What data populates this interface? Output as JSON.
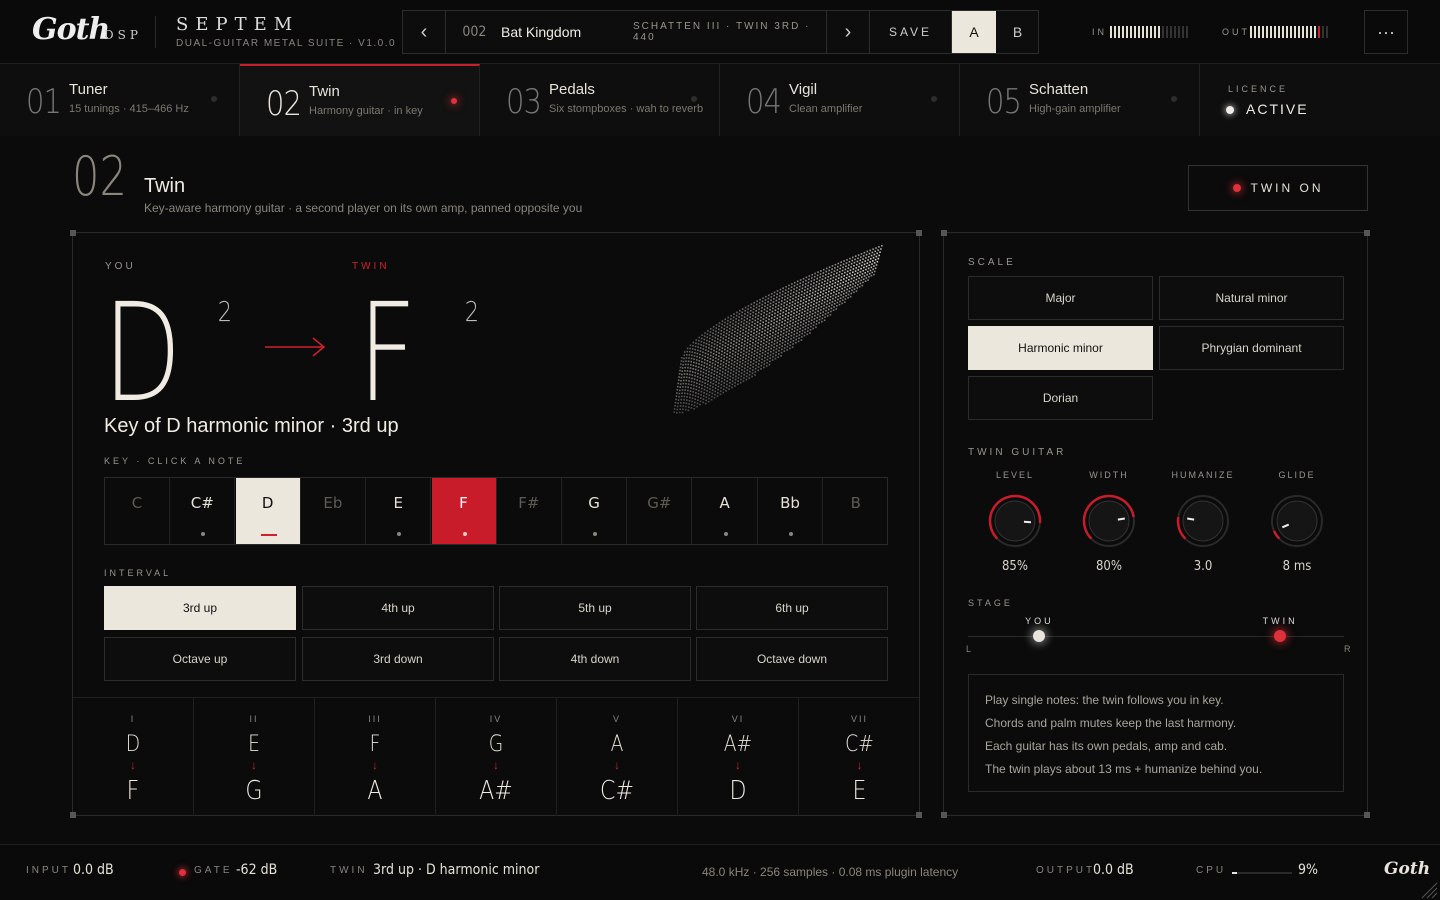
{
  "brand": {
    "logo": "Goth",
    "dsp": "DSP",
    "product": "SEPTEM",
    "subtitle": "DUAL-GUITAR METAL SUITE · V1.0.0"
  },
  "preset": {
    "number": "002",
    "name": "Bat Kingdom",
    "detail": "SCHATTEN III · TWIN 3RD · 440",
    "save": "SAVE",
    "a": "A",
    "b": "B",
    "prev": "‹",
    "next": "›"
  },
  "meters": {
    "in_label": "IN",
    "out_label": "OUT",
    "in_level": 0.67,
    "out_level": 0.89
  },
  "menu": "···",
  "tabs": [
    {
      "num": "01",
      "title": "Tuner",
      "sub": "15 tunings · 415–466 Hz"
    },
    {
      "num": "02",
      "title": "Twin",
      "sub": "Harmony guitar · in key"
    },
    {
      "num": "03",
      "title": "Pedals",
      "sub": "Six stompboxes · wah to reverb"
    },
    {
      "num": "04",
      "title": "Vigil",
      "sub": "Clean amplifier"
    },
    {
      "num": "05",
      "title": "Schatten",
      "sub": "High-gain amplifier"
    }
  ],
  "licence": {
    "label": "LICENCE",
    "value": "ACTIVE"
  },
  "page": {
    "num": "02",
    "title": "Twin",
    "desc": "Key-aware harmony guitar · a second player on its own amp, panned opposite you",
    "toggle": "TWIN ON"
  },
  "harmony": {
    "you_label": "YOU",
    "twin_label": "TWIN",
    "you_note": "D",
    "you_oct": "2",
    "twin_note": "F",
    "twin_oct": "2",
    "summary": "Key of D harmonic minor · 3rd up",
    "key_label": "KEY · CLICK A NOTE"
  },
  "keys": [
    "C",
    "C#",
    "D",
    "Eb",
    "E",
    "F",
    "F#",
    "G",
    "G#",
    "A",
    "Bb",
    "B"
  ],
  "interval": {
    "label": "INTERVAL",
    "options": [
      "3rd up",
      "4th up",
      "5th up",
      "6th up",
      "Octave up",
      "3rd down",
      "4th down",
      "Octave down"
    ]
  },
  "degrees": [
    {
      "roman": "I",
      "from": "D",
      "to": "F"
    },
    {
      "roman": "II",
      "from": "E",
      "to": "G"
    },
    {
      "roman": "III",
      "from": "F",
      "to": "A"
    },
    {
      "roman": "IV",
      "from": "G",
      "to": "A#"
    },
    {
      "roman": "V",
      "from": "A",
      "to": "C#"
    },
    {
      "roman": "VI",
      "from": "A#",
      "to": "D"
    },
    {
      "roman": "VII",
      "from": "C#",
      "to": "E"
    }
  ],
  "scale": {
    "label": "SCALE",
    "options": [
      "Major",
      "Natural minor",
      "Harmonic minor",
      "Phrygian dominant",
      "Dorian"
    ],
    "selected": "Harmonic minor"
  },
  "twin_guitar": {
    "label": "TWIN GUITAR",
    "knobs": [
      {
        "label": "LEVEL",
        "value": "85%",
        "pos": 0.85
      },
      {
        "label": "WIDTH",
        "value": "80%",
        "pos": 0.8
      },
      {
        "label": "HUMANIZE",
        "value": "3.0",
        "pos": 0.2
      },
      {
        "label": "GLIDE",
        "value": "8 ms",
        "pos": 0.08
      }
    ]
  },
  "stage": {
    "label": "STAGE",
    "you": "YOU",
    "twin": "TWIN",
    "left": "L",
    "right": "R",
    "you_pos": 0.19,
    "twin_pos": 0.83
  },
  "info": [
    "Play single notes: the twin follows you in key.",
    "Chords and palm mutes keep the last harmony.",
    "Each guitar has its own pedals, amp and cab.",
    "The twin plays about 13 ms + humanize behind you."
  ],
  "status": {
    "input_label": "INPUT",
    "input": "0.0 dB",
    "gate_label": "GATE",
    "gate": "-62 dB",
    "twin_label": "TWIN",
    "twin": "3rd up · D harmonic minor",
    "engine": "48.0 kHz · 256 samples · 0.08 ms plugin latency",
    "output_label": "OUTPUT",
    "output": "0.0 dB",
    "cpu_label": "CPU",
    "cpu": "9%",
    "cpu_level": 0.09,
    "logo": "Goth"
  },
  "colors": {
    "accent": "#d0202e",
    "cream": "#ece7dc",
    "bg": "#0b0b0b"
  }
}
